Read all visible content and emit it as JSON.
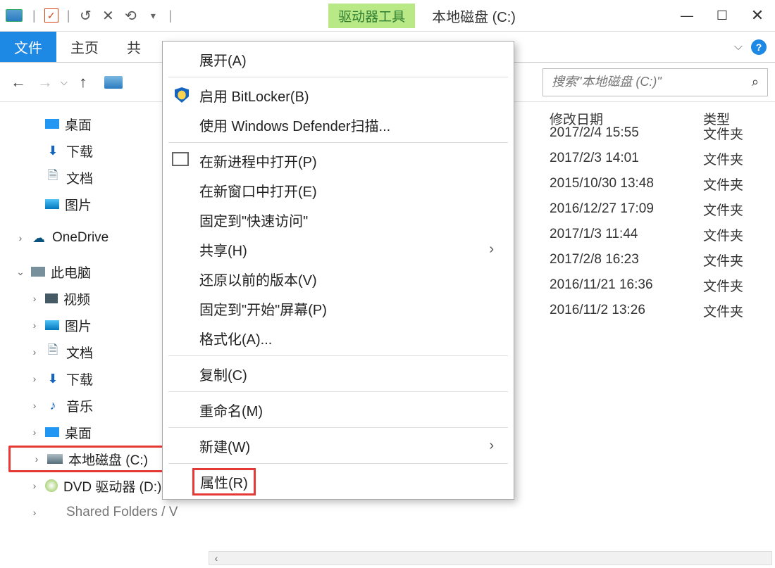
{
  "titlebar": {
    "context_tab": "驱动器工具",
    "title": "本地磁盘 (C:)"
  },
  "ribbon": {
    "file": "文件",
    "home": "主页",
    "partial": "共"
  },
  "nav": {
    "search_placeholder": "搜索\"本地磁盘 (C:)\""
  },
  "tree": {
    "quick": [
      {
        "label": "桌面",
        "icon": "desktop"
      },
      {
        "label": "下载",
        "icon": "download"
      },
      {
        "label": "文档",
        "icon": "doc"
      },
      {
        "label": "图片",
        "icon": "pic"
      }
    ],
    "onedrive": "OneDrive",
    "this_pc": "此电脑",
    "pc_children": [
      {
        "label": "视频",
        "icon": "video"
      },
      {
        "label": "图片",
        "icon": "pic"
      },
      {
        "label": "文档",
        "icon": "doc"
      },
      {
        "label": "下载",
        "icon": "download"
      },
      {
        "label": "音乐",
        "icon": "music"
      },
      {
        "label": "桌面",
        "icon": "desktop"
      },
      {
        "label": "本地磁盘 (C:)",
        "icon": "drive",
        "hl": true
      },
      {
        "label": "DVD 驱动器 (D:)",
        "icon": "dvd"
      }
    ],
    "cut_off": "Shared Folders / V"
  },
  "columns": {
    "date": "修改日期",
    "type": "类型"
  },
  "rows": [
    {
      "date": "2017/2/4 15:55",
      "type": "文件夹"
    },
    {
      "date": "2017/2/3 14:01",
      "type": "文件夹"
    },
    {
      "date": "2015/10/30 13:48",
      "type": "文件夹"
    },
    {
      "date": "2016/12/27 17:09",
      "type": "文件夹"
    },
    {
      "date": "2017/1/3 11:44",
      "type": "文件夹"
    },
    {
      "date": "2017/2/8 16:23",
      "type": "文件夹"
    },
    {
      "date": "2016/11/21 16:36",
      "type": "文件夹"
    },
    {
      "date": "2016/11/2 13:26",
      "type": "文件夹"
    }
  ],
  "ctx": {
    "expand": "展开(A)",
    "bitlocker": "启用 BitLocker(B)",
    "defender": "使用 Windows Defender扫描...",
    "new_proc": "在新进程中打开(P)",
    "new_win": "在新窗口中打开(E)",
    "pin_quick": "固定到\"快速访问\"",
    "share": "共享(H)",
    "restore": "还原以前的版本(V)",
    "pin_start": "固定到\"开始\"屏幕(P)",
    "format": "格式化(A)...",
    "copy": "复制(C)",
    "rename": "重命名(M)",
    "new": "新建(W)",
    "properties": "属性(R)"
  }
}
